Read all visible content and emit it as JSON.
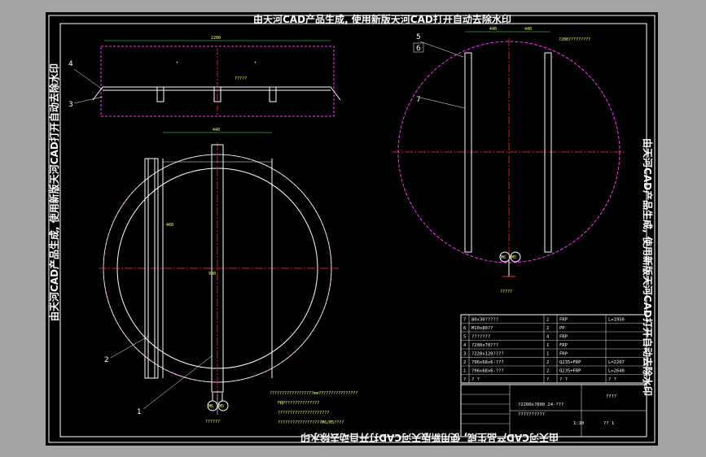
{
  "watermark": {
    "top": "由天河CAD产品生成, 使用新版天河CAD打开自动去除水印",
    "bottom": "由天河CAD产品生成, 使用新版天河CAD打开自动去除水印",
    "left": "由天河CAD产品生成, 使用新版天河CAD打开自动去除水印",
    "right": "由天河CAD产品生成, 使用新版天河CAD打开自动去除水印"
  },
  "part_labels": {
    "p1": "1",
    "p2": "2",
    "p3": "3",
    "p4": "4",
    "p5": "5",
    "p6": "6",
    "p7": "7"
  },
  "bubbles": {
    "m6_a": "M6",
    "m5_a": "M5",
    "m6_b": "M6",
    "m5_b": "M5"
  },
  "notes": [
    "??????????????????mm????????????????",
    "FRP??????????????",
    "?????????????????????",
    "??????????????????M6/M5????"
  ],
  "bom": [
    {
      "no": "7",
      "name": "80x30?????",
      "qty": "2",
      "mat": "FRP",
      "note": "L=1950"
    },
    {
      "no": "6",
      "name": "M10x80??",
      "qty": "2",
      "mat": "PP",
      "note": ""
    },
    {
      "no": "5",
      "name": "???????",
      "qty": "4",
      "mat": "FRP",
      "note": ""
    },
    {
      "no": "4",
      "name": "?200x70???",
      "qty": "1",
      "mat": "FRP",
      "note": ""
    },
    {
      "no": "3",
      "name": "?220x120????",
      "qty": "1",
      "mat": "FRP",
      "note": ""
    },
    {
      "no": "2",
      "name": "?96x68x6-???",
      "qty": "2",
      "mat": "Q235+FRP",
      "note": "L=2207"
    },
    {
      "no": "1",
      "name": "?96x68x6-???",
      "qty": "2",
      "mat": "Q235+FRP",
      "note": "L=2640"
    }
  ],
  "bom_header": {
    "no": "?",
    "name": "? ?",
    "qty": "?",
    "mat": "? ?",
    "note": "? ?"
  },
  "title_block": {
    "drawing_no": "?2200x?000 24-???",
    "title": "????",
    "scale": "1:10",
    "sheet": "?? 1",
    "small": "??????????"
  },
  "colors": {
    "bg": "#000000",
    "frame": "#ffffff",
    "magenta": "#ff33ff",
    "red_center": "#ff3333",
    "green": "#33ff66",
    "cyan": "#33ffff",
    "yellow": "#ffff66"
  }
}
